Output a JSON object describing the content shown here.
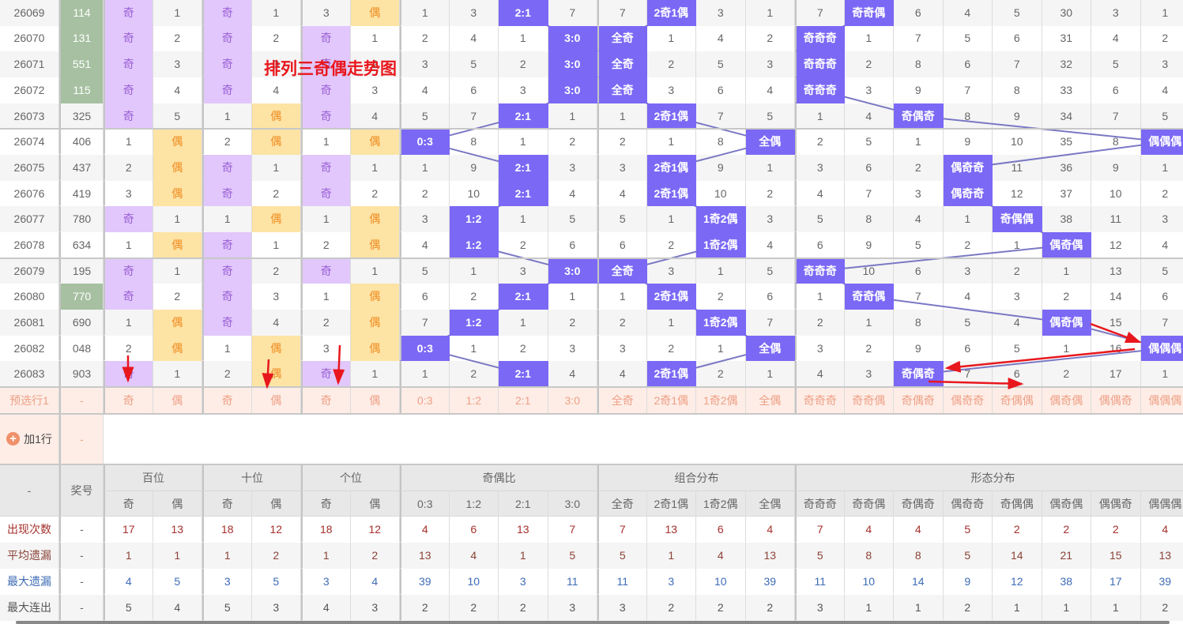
{
  "title_overlay": "排列三奇偶走势图",
  "headers": {
    "corner": "-",
    "number": "奖号",
    "groups": [
      {
        "label": "百位",
        "cols": [
          "奇",
          "偶"
        ]
      },
      {
        "label": "十位",
        "cols": [
          "奇",
          "偶"
        ]
      },
      {
        "label": "个位",
        "cols": [
          "奇",
          "偶"
        ]
      },
      {
        "label": "奇偶比",
        "cols": [
          "0:3",
          "1:2",
          "2:1",
          "3:0"
        ]
      },
      {
        "label": "组合分布",
        "cols": [
          "全奇",
          "2奇1偶",
          "1奇2偶",
          "全偶"
        ]
      },
      {
        "label": "形态分布",
        "cols": [
          "奇奇奇",
          "奇奇偶",
          "奇偶奇",
          "偶奇奇",
          "奇偶偶",
          "偶奇偶",
          "偶偶奇",
          "偶偶偶"
        ]
      }
    ]
  },
  "rows": [
    {
      "issue": "26069",
      "number": "114",
      "marked": true,
      "cells": [
        "奇",
        "1",
        "奇",
        "1",
        "3",
        "偶",
        "1",
        "3",
        "2:1",
        "7",
        "7",
        "2奇1偶",
        "3",
        "1",
        "7",
        "奇奇偶",
        "6",
        "4",
        "5",
        "30",
        "3",
        "1"
      ]
    },
    {
      "issue": "26070",
      "number": "131",
      "marked": true,
      "cells": [
        "奇",
        "2",
        "奇",
        "2",
        "奇",
        "1",
        "2",
        "4",
        "1",
        "3:0",
        "全奇",
        "1",
        "4",
        "2",
        "奇奇奇",
        "1",
        "7",
        "5",
        "6",
        "31",
        "4",
        "2"
      ]
    },
    {
      "issue": "26071",
      "number": "551",
      "marked": true,
      "cells": [
        "奇",
        "3",
        "奇",
        "3",
        "奇",
        "2",
        "3",
        "5",
        "2",
        "3:0",
        "全奇",
        "2",
        "5",
        "3",
        "奇奇奇",
        "2",
        "8",
        "6",
        "7",
        "32",
        "5",
        "3"
      ]
    },
    {
      "issue": "26072",
      "number": "115",
      "marked": true,
      "cells": [
        "奇",
        "4",
        "奇",
        "4",
        "奇",
        "3",
        "4",
        "6",
        "3",
        "3:0",
        "全奇",
        "3",
        "6",
        "4",
        "奇奇奇",
        "3",
        "9",
        "7",
        "8",
        "33",
        "6",
        "4"
      ]
    },
    {
      "issue": "26073",
      "number": "325",
      "marked": false,
      "cells": [
        "奇",
        "5",
        "1",
        "偶",
        "奇",
        "4",
        "5",
        "7",
        "2:1",
        "1",
        "1",
        "2奇1偶",
        "7",
        "5",
        "1",
        "4",
        "奇偶奇",
        "8",
        "9",
        "34",
        "7",
        "5"
      ]
    },
    {
      "issue": "26074",
      "number": "406",
      "marked": false,
      "cells": [
        "1",
        "偶",
        "2",
        "偶",
        "1",
        "偶",
        "0:3",
        "8",
        "1",
        "2",
        "2",
        "1",
        "8",
        "全偶",
        "2",
        "5",
        "1",
        "9",
        "10",
        "35",
        "8",
        "偶偶偶"
      ]
    },
    {
      "issue": "26075",
      "number": "437",
      "marked": false,
      "cells": [
        "2",
        "偶",
        "奇",
        "1",
        "奇",
        "1",
        "1",
        "9",
        "2:1",
        "3",
        "3",
        "2奇1偶",
        "9",
        "1",
        "3",
        "6",
        "2",
        "偶奇奇",
        "11",
        "36",
        "9",
        "1"
      ]
    },
    {
      "issue": "26076",
      "number": "419",
      "marked": false,
      "cells": [
        "3",
        "偶",
        "奇",
        "2",
        "奇",
        "2",
        "2",
        "10",
        "2:1",
        "4",
        "4",
        "2奇1偶",
        "10",
        "2",
        "4",
        "7",
        "3",
        "偶奇奇",
        "12",
        "37",
        "10",
        "2"
      ]
    },
    {
      "issue": "26077",
      "number": "780",
      "marked": false,
      "cells": [
        "奇",
        "1",
        "1",
        "偶",
        "1",
        "偶",
        "3",
        "1:2",
        "1",
        "5",
        "5",
        "1",
        "1奇2偶",
        "3",
        "5",
        "8",
        "4",
        "1",
        "奇偶偶",
        "38",
        "11",
        "3"
      ]
    },
    {
      "issue": "26078",
      "number": "634",
      "marked": false,
      "cells": [
        "1",
        "偶",
        "奇",
        "1",
        "2",
        "偶",
        "4",
        "1:2",
        "2",
        "6",
        "6",
        "2",
        "1奇2偶",
        "4",
        "6",
        "9",
        "5",
        "2",
        "1",
        "偶奇偶",
        "12",
        "4"
      ]
    },
    {
      "issue": "26079",
      "number": "195",
      "marked": false,
      "cells": [
        "奇",
        "1",
        "奇",
        "2",
        "奇",
        "1",
        "5",
        "1",
        "3",
        "3:0",
        "全奇",
        "3",
        "1",
        "5",
        "奇奇奇",
        "10",
        "6",
        "3",
        "2",
        "1",
        "13",
        "5"
      ]
    },
    {
      "issue": "26080",
      "number": "770",
      "marked": true,
      "cells": [
        "奇",
        "2",
        "奇",
        "3",
        "1",
        "偶",
        "6",
        "2",
        "2:1",
        "1",
        "1",
        "2奇1偶",
        "2",
        "6",
        "1",
        "奇奇偶",
        "7",
        "4",
        "3",
        "2",
        "14",
        "6"
      ]
    },
    {
      "issue": "26081",
      "number": "690",
      "marked": false,
      "cells": [
        "1",
        "偶",
        "奇",
        "4",
        "2",
        "偶",
        "7",
        "1:2",
        "1",
        "2",
        "2",
        "1",
        "1奇2偶",
        "7",
        "2",
        "1",
        "8",
        "5",
        "4",
        "偶奇偶",
        "15",
        "7"
      ]
    },
    {
      "issue": "26082",
      "number": "048",
      "marked": false,
      "cells": [
        "2",
        "偶",
        "1",
        "偶",
        "3",
        "偶",
        "0:3",
        "1",
        "2",
        "3",
        "3",
        "2",
        "1",
        "全偶",
        "3",
        "2",
        "9",
        "6",
        "5",
        "1",
        "16",
        "偶偶偶"
      ]
    },
    {
      "issue": "26083",
      "number": "903",
      "marked": false,
      "cells": [
        "奇",
        "1",
        "2",
        "偶",
        "奇",
        "1",
        "1",
        "2",
        "2:1",
        "4",
        "4",
        "2奇1偶",
        "2",
        "1",
        "4",
        "3",
        "奇偶奇",
        "7",
        "6",
        "2",
        "17",
        "1"
      ]
    }
  ],
  "preselect": {
    "label": "预选行1",
    "number": "-",
    "cells": [
      "奇",
      "偶",
      "奇",
      "偶",
      "奇",
      "偶",
      "0:3",
      "1:2",
      "2:1",
      "3:0",
      "全奇",
      "2奇1偶",
      "1奇2偶",
      "全偶",
      "奇奇奇",
      "奇奇偶",
      "奇偶奇",
      "偶奇奇",
      "奇偶偶",
      "偶奇偶",
      "偶偶奇",
      "偶偶偶"
    ]
  },
  "add_row": {
    "icon": "plus-circle-icon",
    "label": "加1行",
    "number": "-"
  },
  "stats": [
    {
      "label": "出现次数",
      "number": "-",
      "color": "#a5302c",
      "values": [
        "17",
        "13",
        "18",
        "12",
        "18",
        "12",
        "4",
        "6",
        "13",
        "7",
        "7",
        "13",
        "6",
        "4",
        "7",
        "4",
        "4",
        "5",
        "2",
        "2",
        "2",
        "4"
      ]
    },
    {
      "label": "平均遗漏",
      "number": "-",
      "color": "#8b4338",
      "values": [
        "1",
        "1",
        "1",
        "2",
        "1",
        "2",
        "13",
        "4",
        "1",
        "5",
        "5",
        "1",
        "4",
        "13",
        "5",
        "8",
        "8",
        "5",
        "14",
        "21",
        "15",
        "13"
      ]
    },
    {
      "label": "最大遗漏",
      "number": "-",
      "color": "#3d6bb5",
      "values": [
        "4",
        "5",
        "3",
        "5",
        "3",
        "4",
        "39",
        "10",
        "3",
        "11",
        "11",
        "3",
        "10",
        "39",
        "11",
        "10",
        "14",
        "9",
        "12",
        "38",
        "17",
        "39"
      ]
    },
    {
      "label": "最大连出",
      "number": "-",
      "color": "#555555",
      "values": [
        "5",
        "4",
        "5",
        "3",
        "4",
        "3",
        "2",
        "2",
        "2",
        "3",
        "3",
        "2",
        "2",
        "2",
        "3",
        "1",
        "1",
        "2",
        "1",
        "1",
        "1",
        "2"
      ]
    }
  ],
  "colors": {
    "hit": "#7b68f5",
    "odd_bg": "#e1c7fb",
    "even_bg": "#fde3a4",
    "marked_number": "#a6c0a1",
    "trend_line": "#7a78c4",
    "annotation_arrow": "#e8171d"
  }
}
